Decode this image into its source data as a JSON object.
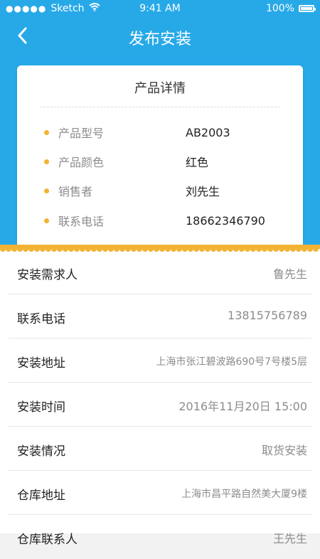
{
  "status_bar": {
    "carrier": "Sketch",
    "time": "9:41 AM",
    "battery": "100%"
  },
  "navbar": {
    "title": "发布安装",
    "back_icon": "chevron-left-icon"
  },
  "product_card": {
    "title": "产品详情",
    "rows": [
      {
        "label": "产品型号",
        "value": "AB2003"
      },
      {
        "label": "产品颜色",
        "value": "红色"
      },
      {
        "label": "销售者",
        "value": "刘先生"
      },
      {
        "label": "联系电话",
        "value": "18662346790"
      }
    ],
    "bullet_color": "#f2b333"
  },
  "details": [
    {
      "label": "安装需求人",
      "value": "鲁先生"
    },
    {
      "label": "联系电话",
      "value": "13815756789"
    },
    {
      "label": "安装地址",
      "value": "上海市张江碧波路690号7号楼5层"
    },
    {
      "label": "安装时间",
      "value": "2016年11月20日  15:00"
    },
    {
      "label": "安装情况",
      "value": "取货安装"
    },
    {
      "label": "仓库地址",
      "value": "上海市昌平路自然美大厦9楼"
    },
    {
      "label": "仓库联系人",
      "value": "王先生"
    }
  ],
  "colors": {
    "primary": "#27a9e8",
    "accent": "#f2b333"
  }
}
